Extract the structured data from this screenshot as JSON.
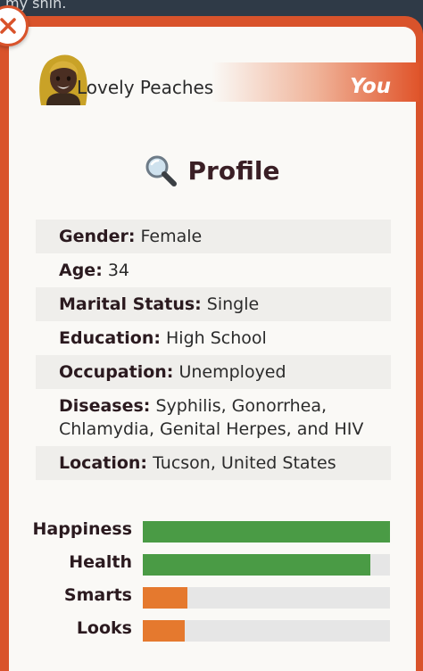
{
  "background_text": "my shin.",
  "character": {
    "name": "Lovely Peaches",
    "badge": "You"
  },
  "profile": {
    "title": "Profile",
    "icon": "magnifying-glass-icon",
    "rows": [
      {
        "label": "Gender:",
        "value": "Female"
      },
      {
        "label": "Age:",
        "value": "34"
      },
      {
        "label": "Marital Status:",
        "value": "Single"
      },
      {
        "label": "Education:",
        "value": "High School"
      },
      {
        "label": "Occupation:",
        "value": "Unemployed"
      },
      {
        "label": "Diseases:",
        "value": "Syphilis, Gonorrhea, Chlamydia, Genital Herpes, and HIV"
      },
      {
        "label": "Location:",
        "value": "Tucson, United States"
      }
    ]
  },
  "stats": [
    {
      "label": "Happiness",
      "percent": 100,
      "color": "#4a9b45"
    },
    {
      "label": "Health",
      "percent": 92,
      "color": "#4a9b45"
    },
    {
      "label": "Smarts",
      "percent": 18,
      "color": "#e5792e"
    },
    {
      "label": "Looks",
      "percent": 17,
      "color": "#e5792e"
    }
  ],
  "colors": {
    "accent": "#d9532b",
    "good": "#4a9b45",
    "low": "#e5792e"
  }
}
